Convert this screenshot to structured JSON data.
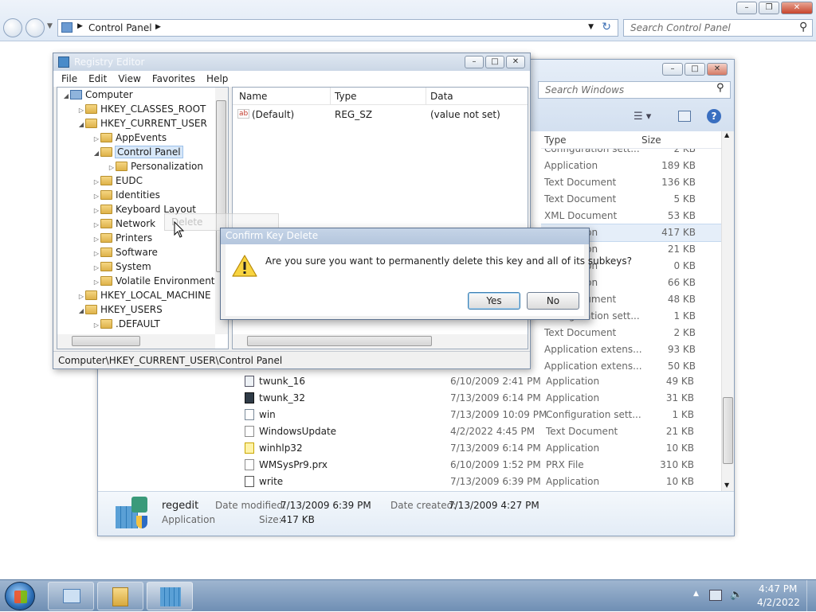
{
  "control_panel": {
    "breadcrumb": "Control Panel",
    "search_placeholder": "Search Control Panel"
  },
  "explorer": {
    "search_placeholder": "Search Windows",
    "columns": {
      "type": "Type",
      "size": "Size"
    },
    "partial_rows": [
      {
        "type": "Configuration sett...",
        "size": "2 KB"
      },
      {
        "type": "Application",
        "size": "189 KB"
      },
      {
        "type": "Text Document",
        "size": "136 KB"
      },
      {
        "type": "Text Document",
        "size": "5 KB"
      },
      {
        "type": "XML Document",
        "size": "53 KB"
      },
      {
        "type": "Application",
        "size": "417 KB"
      },
      {
        "type": "Application",
        "size": "21 KB"
      },
      {
        "type": "Application",
        "size": "0 KB"
      },
      {
        "type": "Application",
        "size": "66 KB"
      },
      {
        "type": "Text Document",
        "size": "48 KB"
      },
      {
        "type": "Configuration sett...",
        "size": "1 KB"
      },
      {
        "type": "Text Document",
        "size": "2 KB"
      },
      {
        "type": "Application extens...",
        "size": "93 KB"
      },
      {
        "type": "Application extens...",
        "size": "50 KB"
      }
    ],
    "files": [
      {
        "name": "twunk_16",
        "date": "6/10/2009 2:41 PM",
        "type": "Application",
        "size": "49 KB"
      },
      {
        "name": "twunk_32",
        "date": "7/13/2009 6:14 PM",
        "type": "Application",
        "size": "31 KB"
      },
      {
        "name": "win",
        "date": "7/13/2009 10:09 PM",
        "type": "Configuration sett...",
        "size": "1 KB"
      },
      {
        "name": "WindowsUpdate",
        "date": "4/2/2022 4:45 PM",
        "type": "Text Document",
        "size": "21 KB"
      },
      {
        "name": "winhlp32",
        "date": "7/13/2009 6:14 PM",
        "type": "Application",
        "size": "10 KB"
      },
      {
        "name": "WMSysPr9.prx",
        "date": "6/10/2009 1:52 PM",
        "type": "PRX File",
        "size": "310 KB"
      },
      {
        "name": "write",
        "date": "7/13/2009 6:39 PM",
        "type": "Application",
        "size": "10 KB"
      }
    ],
    "details": {
      "name": "regedit",
      "kind": "Application",
      "date_modified_label": "Date modified:",
      "date_modified": "7/13/2009 6:39 PM",
      "date_created_label": "Date created:",
      "date_created": "7/13/2009 4:27 PM",
      "size_label": "Size:",
      "size": "417 KB"
    }
  },
  "regedit": {
    "title": "Registry Editor",
    "menu": [
      "File",
      "Edit",
      "View",
      "Favorites",
      "Help"
    ],
    "tree": [
      {
        "label": "Computer",
        "expanded": true
      },
      {
        "label": "HKEY_CLASSES_ROOT"
      },
      {
        "label": "HKEY_CURRENT_USER",
        "expanded": true
      },
      {
        "label": "AppEvents"
      },
      {
        "label": "Control Panel",
        "expanded": true,
        "selected": true
      },
      {
        "label": "Personalization"
      },
      {
        "label": "EUDC"
      },
      {
        "label": "Identities"
      },
      {
        "label": "Keyboard Layout"
      },
      {
        "label": "Network"
      },
      {
        "label": "Printers"
      },
      {
        "label": "Software"
      },
      {
        "label": "System"
      },
      {
        "label": "Volatile Environment"
      },
      {
        "label": "HKEY_LOCAL_MACHINE"
      },
      {
        "label": "HKEY_USERS",
        "expanded": true
      },
      {
        "label": ".DEFAULT"
      }
    ],
    "context_menu_item": "Delete",
    "list_columns": {
      "name": "Name",
      "type": "Type",
      "data": "Data"
    },
    "values": [
      {
        "icon": "ab",
        "name": "(Default)",
        "type": "REG_SZ",
        "data": "(value not set)"
      }
    ],
    "status": "Computer\\HKEY_CURRENT_USER\\Control Panel"
  },
  "dialog": {
    "title": "Confirm Key Delete",
    "message": "Are you sure you want to permanently delete this key and all of its subkeys?",
    "yes": "Yes",
    "no": "No"
  },
  "taskbar": {
    "time": "4:47 PM",
    "date": "4/2/2022"
  }
}
